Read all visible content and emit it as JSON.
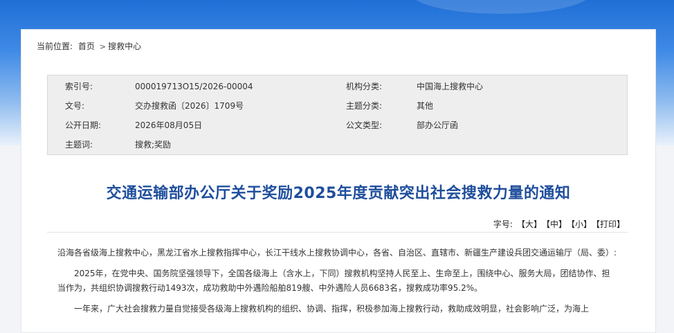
{
  "breadcrumb": {
    "label": "当前位置:",
    "home": "首页",
    "sep": ">",
    "current": "搜救中心"
  },
  "meta": {
    "index_label": "索引号:",
    "index_value": "000019713O15/2026-00004",
    "org_label": "机构分类:",
    "org_value": "中国海上搜救中心",
    "doc_label": "文号:",
    "doc_value": "交办搜救函〔2026〕1709号",
    "topic_label": "主题分类:",
    "topic_value": "其他",
    "date_label": "公开日期:",
    "date_value": "2026年08月05日",
    "type_label": "公文类型:",
    "type_value": "部办公厅函",
    "keywords_label": "主题词:",
    "keywords_value": "搜救;奖励"
  },
  "title": "交通运输部办公厅关于奖励2025年度贡献突出社会搜救力量的通知",
  "font_size": {
    "label": "字号:",
    "large": "【大】",
    "medium": "【中】",
    "small": "【小】",
    "print": "【打印】"
  },
  "body": {
    "p1": "沿海各省级海上搜救中心，黑龙江省水上搜救指挥中心，长江干线水上搜救协调中心，各省、自治区、直辖市、新疆生产建设兵团交通运输厅（局、委）:",
    "p2": "2025年，在党中央、国务院坚强领导下，全国各级海上（含水上，下同）搜救机构坚持人民至上、生命至上，围绕中心、服务大局，团结协作、担当作为，共组织协调搜救行动1493次，成功救助中外遇险船舶819艘、中外遇险人员6683名，搜救成功率95.2%。",
    "p3": "一年来，广大社会搜救力量自觉接受各级海上搜救机构的组织、协调、指挥，积极参加海上搜救行动，救助成效明显，社会影响广泛，为海上"
  }
}
